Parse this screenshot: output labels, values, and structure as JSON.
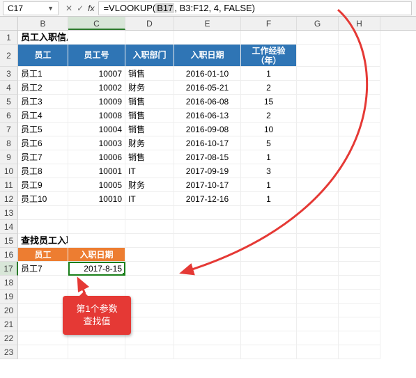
{
  "topbar": {
    "namebox": "C17",
    "cancel": "✕",
    "confirm": "✓",
    "fx": "fx",
    "formula_prefix": "=VLOOKUP( ",
    "formula_arg1": "B17",
    "formula_rest": ", B3:F12, 4, FALSE)"
  },
  "cols": [
    "B",
    "C",
    "D",
    "E",
    "F",
    "G",
    "H"
  ],
  "rows": [
    "1",
    "2",
    "3",
    "4",
    "5",
    "6",
    "7",
    "8",
    "9",
    "10",
    "11",
    "12",
    "13",
    "14",
    "15",
    "16",
    "17",
    "18",
    "19",
    "20",
    "21",
    "22",
    "23"
  ],
  "titles": {
    "main": "员工入职信息",
    "lookup": "查找员工入职信息"
  },
  "headers": {
    "emp": "员工",
    "empno": "员工号",
    "dept": "入职部门",
    "date": "入职日期",
    "exp1": "工作经验",
    "exp2": "（年）"
  },
  "lookup_headers": {
    "emp": "员工",
    "date": "入职日期"
  },
  "lookup_row": {
    "emp": "员工7",
    "date": "2017-8-15"
  },
  "table": [
    {
      "emp": "员工1",
      "no": "10007",
      "dept": "销售",
      "date": "2016-01-10",
      "exp": "1"
    },
    {
      "emp": "员工2",
      "no": "10002",
      "dept": "财务",
      "date": "2016-05-21",
      "exp": "2"
    },
    {
      "emp": "员工3",
      "no": "10009",
      "dept": "销售",
      "date": "2016-06-08",
      "exp": "15"
    },
    {
      "emp": "员工4",
      "no": "10008",
      "dept": "销售",
      "date": "2016-06-13",
      "exp": "2"
    },
    {
      "emp": "员工5",
      "no": "10004",
      "dept": "销售",
      "date": "2016-09-08",
      "exp": "10"
    },
    {
      "emp": "员工6",
      "no": "10003",
      "dept": "财务",
      "date": "2016-10-17",
      "exp": "5"
    },
    {
      "emp": "员工7",
      "no": "10006",
      "dept": "销售",
      "date": "2017-08-15",
      "exp": "1"
    },
    {
      "emp": "员工8",
      "no": "10001",
      "dept": "IT",
      "date": "2017-09-19",
      "exp": "3"
    },
    {
      "emp": "员工9",
      "no": "10005",
      "dept": "财务",
      "date": "2017-10-17",
      "exp": "1"
    },
    {
      "emp": "员工10",
      "no": "10010",
      "dept": "IT",
      "date": "2017-12-16",
      "exp": "1"
    }
  ],
  "callout": {
    "line1": "第1个参数",
    "line2": "查找值"
  }
}
